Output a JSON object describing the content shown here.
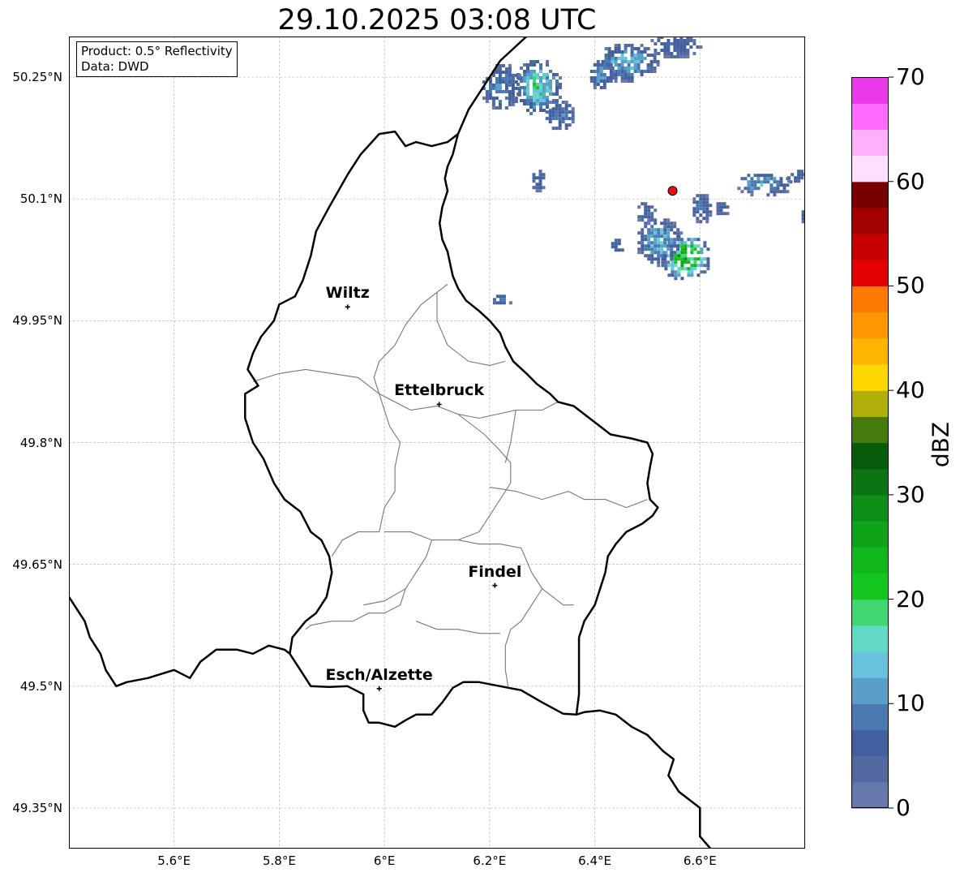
{
  "title": "29.10.2025 03:08 UTC",
  "info_box": {
    "line1": "Product: 0.5° Reflectivity",
    "line2": "Data: DWD"
  },
  "map": {
    "lon_range": [
      5.4,
      6.8
    ],
    "lat_range": [
      49.3,
      50.3
    ],
    "lat_ticks": [
      {
        "value": 50.25,
        "label": "50.25°N"
      },
      {
        "value": 50.1,
        "label": "50.1°N"
      },
      {
        "value": 49.95,
        "label": "49.95°N"
      },
      {
        "value": 49.8,
        "label": "49.8°N"
      },
      {
        "value": 49.65,
        "label": "49.65°N"
      },
      {
        "value": 49.5,
        "label": "49.5°N"
      },
      {
        "value": 49.35,
        "label": "49.35°N"
      }
    ],
    "lon_ticks": [
      {
        "value": 5.6,
        "label": "5.6°E"
      },
      {
        "value": 5.8,
        "label": "5.8°E"
      },
      {
        "value": 6.0,
        "label": "6°E"
      },
      {
        "value": 6.2,
        "label": "6.2°E"
      },
      {
        "value": 6.4,
        "label": "6.4°E"
      },
      {
        "value": 6.6,
        "label": "6.6°E"
      }
    ],
    "gridlines": true,
    "cities": [
      {
        "name": "Wiltz",
        "lon": 5.93,
        "lat": 49.967
      },
      {
        "name": "Ettelbruck",
        "lon": 6.104,
        "lat": 49.847
      },
      {
        "name": "Findel",
        "lon": 6.21,
        "lat": 49.624
      },
      {
        "name": "Esch/Alzette",
        "lon": 5.99,
        "lat": 49.497
      }
    ],
    "radar_site": {
      "lon": 6.548,
      "lat": 50.11,
      "color": "#e8100e"
    },
    "country_border": [
      [
        6.14,
        50.18
      ],
      [
        6.13,
        50.155
      ],
      [
        6.12,
        50.14
      ],
      [
        6.115,
        50.125
      ],
      [
        6.12,
        50.11
      ],
      [
        6.11,
        50.09
      ],
      [
        6.105,
        50.07
      ],
      [
        6.11,
        50.05
      ],
      [
        6.12,
        50.035
      ],
      [
        6.125,
        50.02
      ],
      [
        6.13,
        50.005
      ],
      [
        6.14,
        49.99
      ],
      [
        6.155,
        49.975
      ],
      [
        6.18,
        49.962
      ],
      [
        6.2,
        49.95
      ],
      [
        6.22,
        49.935
      ],
      [
        6.23,
        49.918
      ],
      [
        6.245,
        49.9
      ],
      [
        6.27,
        49.885
      ],
      [
        6.29,
        49.872
      ],
      [
        6.315,
        49.86
      ],
      [
        6.33,
        49.85
      ],
      [
        6.36,
        49.845
      ],
      [
        6.4,
        49.825
      ],
      [
        6.43,
        49.81
      ],
      [
        6.47,
        49.805
      ],
      [
        6.5,
        49.8
      ],
      [
        6.51,
        49.786
      ],
      [
        6.505,
        49.77
      ],
      [
        6.5,
        49.75
      ],
      [
        6.505,
        49.73
      ],
      [
        6.52,
        49.72
      ],
      [
        6.51,
        49.71
      ],
      [
        6.49,
        49.7
      ],
      [
        6.46,
        49.69
      ],
      [
        6.44,
        49.675
      ],
      [
        6.425,
        49.66
      ],
      [
        6.42,
        49.64
      ],
      [
        6.41,
        49.62
      ],
      [
        6.4,
        49.6
      ],
      [
        6.38,
        49.58
      ],
      [
        6.37,
        49.56
      ],
      [
        6.37,
        49.54
      ],
      [
        6.37,
        49.52
      ],
      [
        6.37,
        49.49
      ],
      [
        6.365,
        49.465
      ],
      [
        6.34,
        49.466
      ],
      [
        6.3,
        49.48
      ],
      [
        6.26,
        49.495
      ],
      [
        6.22,
        49.5
      ],
      [
        6.18,
        49.505
      ],
      [
        6.15,
        49.505
      ],
      [
        6.13,
        49.498
      ],
      [
        6.11,
        49.48
      ],
      [
        6.09,
        49.465
      ],
      [
        6.06,
        49.465
      ],
      [
        6.04,
        49.458
      ],
      [
        6.02,
        49.45
      ],
      [
        5.99,
        49.455
      ],
      [
        5.97,
        49.455
      ],
      [
        5.96,
        49.47
      ],
      [
        5.96,
        49.49
      ],
      [
        5.93,
        49.5
      ],
      [
        5.895,
        49.499
      ],
      [
        5.86,
        49.5
      ],
      [
        5.84,
        49.52
      ],
      [
        5.82,
        49.54
      ],
      [
        5.825,
        49.56
      ],
      [
        5.85,
        49.58
      ],
      [
        5.87,
        49.59
      ],
      [
        5.89,
        49.61
      ],
      [
        5.9,
        49.64
      ],
      [
        5.895,
        49.66
      ],
      [
        5.88,
        49.68
      ],
      [
        5.86,
        49.69
      ],
      [
        5.84,
        49.715
      ],
      [
        5.81,
        49.73
      ],
      [
        5.79,
        49.75
      ],
      [
        5.77,
        49.78
      ],
      [
        5.75,
        49.8
      ],
      [
        5.735,
        49.83
      ],
      [
        5.735,
        49.86
      ],
      [
        5.76,
        49.87
      ],
      [
        5.74,
        49.89
      ],
      [
        5.75,
        49.91
      ],
      [
        5.765,
        49.93
      ],
      [
        5.79,
        49.95
      ],
      [
        5.8,
        49.97
      ],
      [
        5.83,
        49.98
      ],
      [
        5.845,
        50.0
      ],
      [
        5.86,
        50.03
      ],
      [
        5.87,
        50.06
      ],
      [
        5.895,
        50.09
      ],
      [
        5.93,
        50.13
      ],
      [
        5.955,
        50.155
      ],
      [
        5.99,
        50.18
      ],
      [
        6.02,
        50.183
      ],
      [
        6.04,
        50.165
      ],
      [
        6.06,
        50.17
      ],
      [
        6.09,
        50.165
      ],
      [
        6.12,
        50.17
      ],
      [
        6.13,
        50.175
      ],
      [
        6.14,
        50.18
      ]
    ],
    "outer_borders": [
      [
        [
          5.4,
          49.61
        ],
        [
          5.43,
          49.58
        ],
        [
          5.44,
          49.56
        ],
        [
          5.46,
          49.54
        ],
        [
          5.47,
          49.52
        ],
        [
          5.49,
          49.5
        ],
        [
          5.51,
          49.505
        ],
        [
          5.55,
          49.51
        ],
        [
          5.6,
          49.52
        ],
        [
          5.63,
          49.51
        ],
        [
          5.65,
          49.53
        ],
        [
          5.68,
          49.545
        ],
        [
          5.72,
          49.545
        ],
        [
          5.75,
          49.54
        ],
        [
          5.78,
          49.55
        ],
        [
          5.81,
          49.545
        ],
        [
          5.82,
          49.54
        ]
      ],
      [
        [
          6.365,
          49.465
        ],
        [
          6.38,
          49.468
        ],
        [
          6.41,
          49.47
        ],
        [
          6.44,
          49.465
        ],
        [
          6.47,
          49.45
        ],
        [
          6.5,
          49.44
        ],
        [
          6.53,
          49.42
        ],
        [
          6.55,
          49.41
        ],
        [
          6.54,
          49.39
        ],
        [
          6.56,
          49.37
        ],
        [
          6.58,
          49.36
        ],
        [
          6.6,
          49.35
        ],
        [
          6.6,
          49.33
        ],
        [
          6.6,
          49.315
        ],
        [
          6.62,
          49.3
        ]
      ],
      [
        [
          6.14,
          50.18
        ],
        [
          6.16,
          50.21
        ],
        [
          6.19,
          50.24
        ],
        [
          6.22,
          50.27
        ],
        [
          6.27,
          50.3
        ]
      ]
    ],
    "canton_borders": [
      [
        [
          5.99,
          49.86
        ],
        [
          5.98,
          49.88
        ],
        [
          5.99,
          49.9
        ],
        [
          6.02,
          49.92
        ],
        [
          6.04,
          49.945
        ],
        [
          6.07,
          49.97
        ],
        [
          6.1,
          49.985
        ],
        [
          6.12,
          49.995
        ]
      ],
      [
        [
          5.75,
          49.875
        ],
        [
          5.8,
          49.885
        ],
        [
          5.85,
          49.89
        ],
        [
          5.9,
          49.885
        ],
        [
          5.95,
          49.88
        ],
        [
          5.99,
          49.86
        ],
        [
          6.05,
          49.84
        ],
        [
          6.1,
          49.845
        ],
        [
          6.14,
          49.835
        ],
        [
          6.18,
          49.83
        ],
        [
          6.25,
          49.84
        ],
        [
          6.3,
          49.84
        ],
        [
          6.33,
          49.85
        ]
      ],
      [
        [
          6.1,
          49.985
        ],
        [
          6.1,
          49.95
        ],
        [
          6.12,
          49.92
        ],
        [
          6.16,
          49.9
        ],
        [
          6.2,
          49.895
        ],
        [
          6.23,
          49.9
        ]
      ],
      [
        [
          5.99,
          49.86
        ],
        [
          6.01,
          49.82
        ],
        [
          6.03,
          49.8
        ],
        [
          6.02,
          49.77
        ],
        [
          6.02,
          49.74
        ],
        [
          6.0,
          49.72
        ],
        [
          5.99,
          49.69
        ],
        [
          5.95,
          49.69
        ],
        [
          5.92,
          49.68
        ],
        [
          5.9,
          49.66
        ]
      ],
      [
        [
          6.14,
          49.835
        ],
        [
          6.19,
          49.81
        ],
        [
          6.22,
          49.79
        ],
        [
          6.24,
          49.775
        ],
        [
          6.24,
          49.75
        ],
        [
          6.22,
          49.73
        ],
        [
          6.2,
          49.71
        ],
        [
          6.18,
          49.69
        ],
        [
          6.14,
          49.68
        ],
        [
          6.09,
          49.68
        ],
        [
          6.05,
          49.69
        ],
        [
          6.0,
          49.69
        ]
      ],
      [
        [
          6.25,
          49.84
        ],
        [
          6.24,
          49.8
        ],
        [
          6.23,
          49.775
        ]
      ],
      [
        [
          6.2,
          49.745
        ],
        [
          6.25,
          49.74
        ],
        [
          6.3,
          49.73
        ],
        [
          6.35,
          49.74
        ],
        [
          6.38,
          49.73
        ],
        [
          6.42,
          49.73
        ],
        [
          6.46,
          49.72
        ],
        [
          6.5,
          49.73
        ]
      ],
      [
        [
          6.09,
          49.68
        ],
        [
          6.08,
          49.66
        ],
        [
          6.06,
          49.64
        ],
        [
          6.04,
          49.62
        ],
        [
          6.03,
          49.6
        ],
        [
          6.0,
          49.59
        ],
        [
          5.97,
          49.59
        ],
        [
          5.94,
          49.58
        ],
        [
          5.9,
          49.58
        ],
        [
          5.86,
          49.575
        ],
        [
          5.85,
          49.57
        ]
      ],
      [
        [
          6.04,
          49.62
        ],
        [
          6.0,
          49.605
        ],
        [
          5.96,
          49.6
        ]
      ],
      [
        [
          6.14,
          49.68
        ],
        [
          6.18,
          49.675
        ],
        [
          6.22,
          49.675
        ],
        [
          6.26,
          49.67
        ],
        [
          6.28,
          49.64
        ],
        [
          6.3,
          49.62
        ],
        [
          6.32,
          49.61
        ],
        [
          6.34,
          49.6
        ],
        [
          6.36,
          49.6
        ]
      ],
      [
        [
          6.3,
          49.62
        ],
        [
          6.28,
          49.6
        ],
        [
          6.26,
          49.58
        ],
        [
          6.24,
          49.57
        ],
        [
          6.23,
          49.55
        ],
        [
          6.23,
          49.52
        ],
        [
          6.235,
          49.5
        ]
      ],
      [
        [
          6.06,
          49.58
        ],
        [
          6.1,
          49.57
        ],
        [
          6.14,
          49.57
        ],
        [
          6.18,
          49.565
        ],
        [
          6.22,
          49.565
        ]
      ]
    ],
    "radar_echoes": [
      {
        "lon": 6.29,
        "lat": 50.24,
        "rx": 0.045,
        "ry": 0.035,
        "level": 8
      },
      {
        "lon": 6.22,
        "lat": 50.24,
        "rx": 0.04,
        "ry": 0.03,
        "level": 4
      },
      {
        "lon": 6.33,
        "lat": 50.205,
        "rx": 0.03,
        "ry": 0.02,
        "level": 4
      },
      {
        "lon": 6.29,
        "lat": 50.125,
        "rx": 0.015,
        "ry": 0.015,
        "level": 3
      },
      {
        "lon": 6.46,
        "lat": 50.27,
        "rx": 0.06,
        "ry": 0.025,
        "level": 6
      },
      {
        "lon": 6.55,
        "lat": 50.29,
        "rx": 0.05,
        "ry": 0.015,
        "level": 3
      },
      {
        "lon": 6.41,
        "lat": 50.255,
        "rx": 0.025,
        "ry": 0.02,
        "level": 5
      },
      {
        "lon": 6.72,
        "lat": 50.12,
        "rx": 0.055,
        "ry": 0.015,
        "level": 6
      },
      {
        "lon": 6.78,
        "lat": 50.13,
        "rx": 0.02,
        "ry": 0.01,
        "level": 3
      },
      {
        "lon": 6.57,
        "lat": 50.03,
        "rx": 0.05,
        "ry": 0.03,
        "level": 12
      },
      {
        "lon": 6.52,
        "lat": 50.05,
        "rx": 0.045,
        "ry": 0.03,
        "level": 6
      },
      {
        "lon": 6.495,
        "lat": 50.085,
        "rx": 0.02,
        "ry": 0.015,
        "level": 3
      },
      {
        "lon": 6.6,
        "lat": 50.09,
        "rx": 0.02,
        "ry": 0.02,
        "level": 4
      },
      {
        "lon": 6.64,
        "lat": 50.09,
        "rx": 0.015,
        "ry": 0.01,
        "level": 3
      },
      {
        "lon": 6.44,
        "lat": 50.045,
        "rx": 0.015,
        "ry": 0.01,
        "level": 4
      },
      {
        "lon": 6.22,
        "lat": 49.978,
        "rx": 0.02,
        "ry": 0.008,
        "level": 3
      },
      {
        "lon": 6.795,
        "lat": 50.075,
        "rx": 0.008,
        "ry": 0.015,
        "level": 3
      }
    ]
  },
  "colorbar": {
    "label": "dBZ",
    "min": 0,
    "max": 70,
    "ticks": [
      "0",
      "10",
      "20",
      "30",
      "40",
      "50",
      "60",
      "70"
    ],
    "colors": [
      "#6478ab",
      "#5468a0",
      "#42609f",
      "#4a78b0",
      "#5a9fc8",
      "#68c2dc",
      "#62d9c6",
      "#3fd673",
      "#12c81f",
      "#10b81d",
      "#0fa31a",
      "#0e8e16",
      "#0b7413",
      "#075b0d",
      "#457a0d",
      "#b0b00a",
      "#fed700",
      "#fdb500",
      "#fe9700",
      "#fe7a00",
      "#e50000",
      "#c60000",
      "#a30000",
      "#780000",
      "#fde0fe",
      "#feb0fe",
      "#fe6bfe",
      "#ea3aea"
    ]
  }
}
